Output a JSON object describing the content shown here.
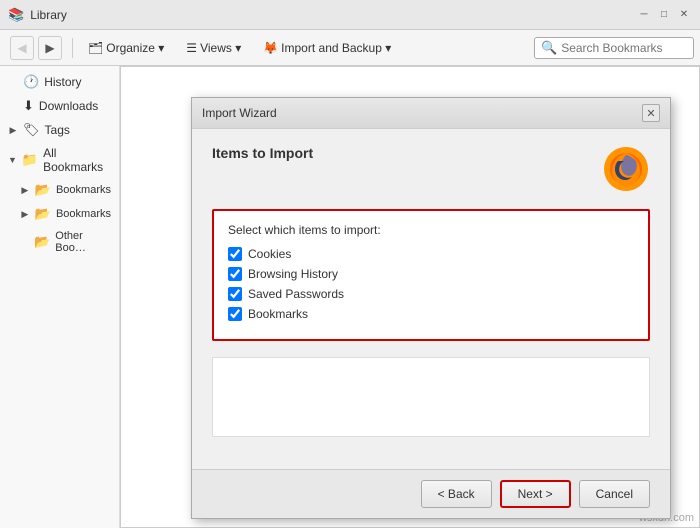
{
  "titlebar": {
    "title": "Library",
    "icon": "📚"
  },
  "toolbar": {
    "back_label": "◀",
    "forward_label": "▶",
    "organize_label": "Organize ▾",
    "views_label": "Views ▾",
    "import_backup_label": "Import and Backup ▾",
    "search_placeholder": "Search Bookmarks"
  },
  "sidebar": {
    "items": [
      {
        "id": "history",
        "label": "History",
        "icon": "🕐",
        "indent": 0,
        "expander": ""
      },
      {
        "id": "downloads",
        "label": "Downloads",
        "icon": "⬇",
        "indent": 0,
        "expander": ""
      },
      {
        "id": "tags",
        "label": "Tags",
        "icon": "🏷",
        "indent": 0,
        "expander": "▶"
      },
      {
        "id": "all-bookmarks",
        "label": "All Bookmarks",
        "icon": "📁",
        "indent": 0,
        "expander": "▼"
      },
      {
        "id": "bookmarks-menu",
        "label": "Bookmarks Menu",
        "icon": "📂",
        "indent": 1,
        "expander": "▶"
      },
      {
        "id": "bookmarks-toolbar",
        "label": "Bookmarks Toolbar",
        "icon": "📂",
        "indent": 1,
        "expander": "▶"
      },
      {
        "id": "other-bookmarks",
        "label": "Other Bookmarks",
        "icon": "📂",
        "indent": 1,
        "expander": ""
      }
    ]
  },
  "modal": {
    "title": "Import Wizard",
    "heading": "Items to Import",
    "close_label": "✕",
    "selection_label": "Select which items to import:",
    "checkboxes": [
      {
        "id": "cookies",
        "label": "Cookies",
        "checked": true
      },
      {
        "id": "browsing-history",
        "label": "Browsing History",
        "checked": true
      },
      {
        "id": "saved-passwords",
        "label": "Saved Passwords",
        "checked": true
      },
      {
        "id": "bookmarks",
        "label": "Bookmarks",
        "checked": true
      }
    ],
    "buttons": {
      "back": "< Back",
      "next": "Next >",
      "cancel": "Cancel"
    }
  },
  "watermark": "wsxdn.com"
}
